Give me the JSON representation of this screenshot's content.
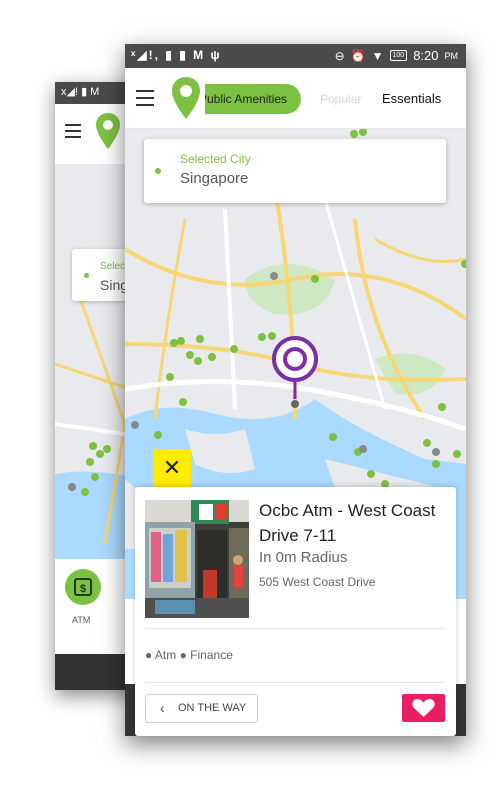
{
  "status_bar": {
    "left_icons": "ˣ◢!, ▮ ▮ M ψ",
    "battery": "100",
    "time": "8:20",
    "ampm": "PM"
  },
  "tabs": {
    "active": "Public Amenities",
    "popular": "Popular",
    "essentials": "Essentials"
  },
  "city": {
    "label": "Selected City",
    "value": "Singapore"
  },
  "back_screen": {
    "city_label": "Selec",
    "city_value": "Sing",
    "atm_label": "ATM"
  },
  "detail": {
    "name": "Ocbc Atm - West Coast Drive 7-11",
    "radius": "In 0m Radius",
    "address": "505 West Coast Drive",
    "tags": "● Atm ● Finance",
    "on_the_way": "ON THE WAY"
  },
  "colors": {
    "accent_green": "#7dc142",
    "close_yellow": "#ffeb00",
    "favorite_pink": "#e91e63",
    "marker_purple": "#7b2fa8"
  }
}
